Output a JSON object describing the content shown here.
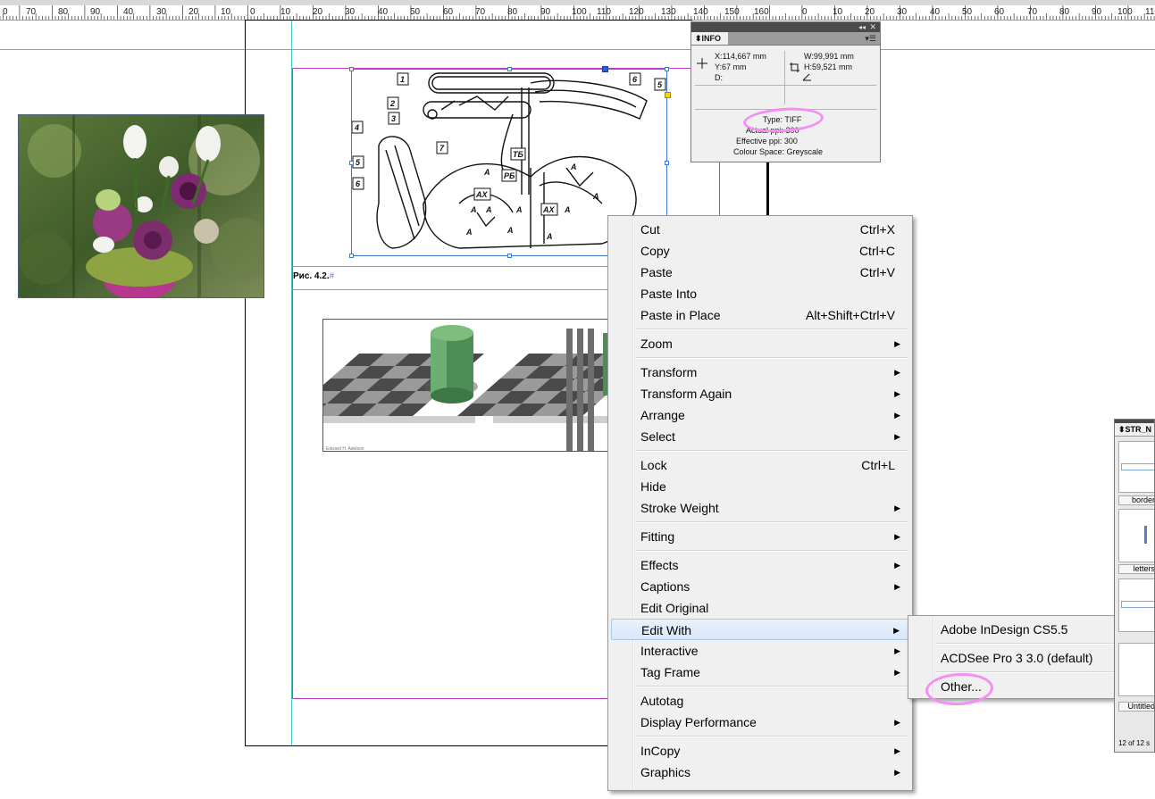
{
  "ruler": {
    "labels_left": [
      "0",
      "70",
      "80",
      "90",
      "40",
      "30",
      "20",
      "10"
    ],
    "labels_right": [
      "0",
      "10",
      "20",
      "30",
      "40",
      "50",
      "60",
      "70",
      "80",
      "90",
      "100",
      "110",
      "120",
      "130",
      "140",
      "150",
      "160",
      "0",
      "10",
      "20",
      "30",
      "40",
      "50",
      "60",
      "70",
      "80",
      "90",
      "100",
      "110",
      "12"
    ]
  },
  "caption": {
    "text": "Рис. 4.2.",
    "hash": "#"
  },
  "info_panel": {
    "tab": "INFO",
    "x": "X:114,667 mm",
    "y": "Y:67 mm",
    "d": "D:",
    "w": "W:99,991 mm",
    "h": "H:59,521 mm",
    "type": "Type: TIFF",
    "actual_ppi": "Actual ppi: 300",
    "effective_ppi": "Effective ppi: 300",
    "colour_space": "Colour Space: Greyscale"
  },
  "drawing_labels": [
    "1",
    "2",
    "3",
    "4",
    "5",
    "6",
    "7",
    "5",
    "6",
    "ТБ",
    "РБ",
    "АХ",
    "АХ",
    "А",
    "А",
    "А",
    "А",
    "А",
    "А",
    "А",
    "А",
    "А",
    "А"
  ],
  "context_menu": {
    "items": [
      {
        "label": "Cut",
        "shortcut": "Ctrl+X"
      },
      {
        "label": "Copy",
        "shortcut": "Ctrl+C"
      },
      {
        "label": "Paste",
        "shortcut": "Ctrl+V"
      },
      {
        "label": "Paste Into",
        "shortcut": ""
      },
      {
        "label": "Paste in Place",
        "shortcut": "Alt+Shift+Ctrl+V"
      },
      {
        "label": "Zoom",
        "submenu": true
      },
      {
        "label": "Transform",
        "submenu": true
      },
      {
        "label": "Transform Again",
        "submenu": true
      },
      {
        "label": "Arrange",
        "submenu": true
      },
      {
        "label": "Select",
        "submenu": true
      },
      {
        "label": "Lock",
        "shortcut": "Ctrl+L"
      },
      {
        "label": "Hide",
        "shortcut": ""
      },
      {
        "label": "Stroke Weight",
        "submenu": true
      },
      {
        "label": "Fitting",
        "submenu": true
      },
      {
        "label": "Effects",
        "submenu": true
      },
      {
        "label": "Captions",
        "submenu": true
      },
      {
        "label": "Edit Original",
        "shortcut": ""
      },
      {
        "label": "Edit With",
        "submenu": true,
        "highlighted": true
      },
      {
        "label": "Interactive",
        "submenu": true
      },
      {
        "label": "Tag Frame",
        "submenu": true
      },
      {
        "label": "Autotag",
        "shortcut": ""
      },
      {
        "label": "Display Performance",
        "submenu": true
      },
      {
        "label": "InCopy",
        "submenu": true
      },
      {
        "label": "Graphics",
        "submenu": true
      }
    ]
  },
  "edit_with_submenu": {
    "items": [
      "Adobe InDesign CS5.5",
      "ACDSee Pro 3 3.0 (default)",
      "Other..."
    ]
  },
  "str_panel": {
    "tab": "STR_N",
    "labels": [
      "border",
      "letters",
      "Untitled"
    ],
    "footer": "12 of 12 s"
  },
  "colors": {
    "accent_highlight": "#f58ef5",
    "menu_bg": "#f0f0f0",
    "selection_blue": "#3c7ad1",
    "guide_cyan": "#39c6cf",
    "margin_magenta": "#c23ac6"
  }
}
